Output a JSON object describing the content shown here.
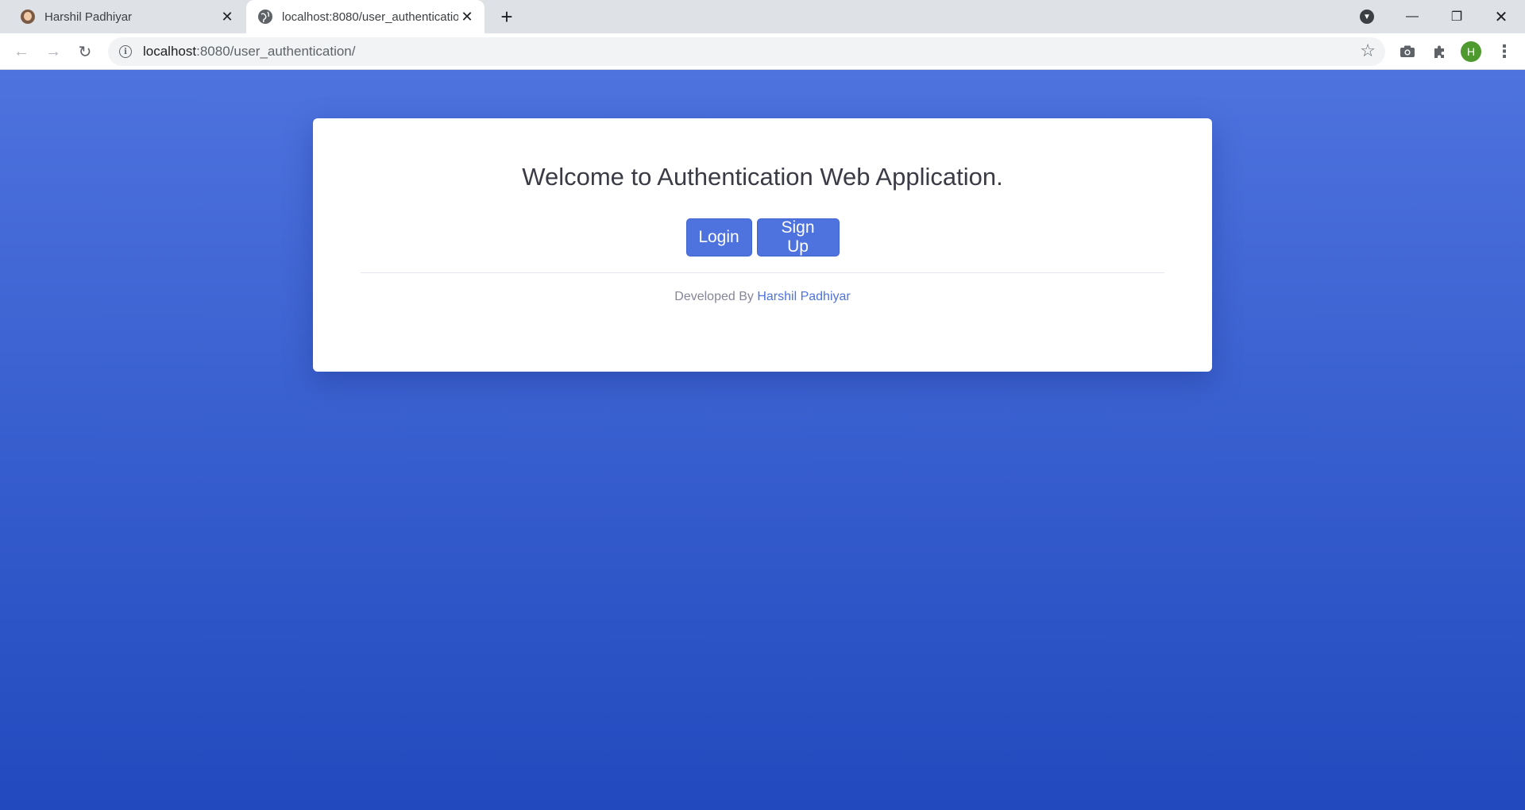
{
  "browser": {
    "tabs": [
      {
        "title": "Harshil Padhiyar",
        "active": false
      },
      {
        "title": "localhost:8080/user_authentication/",
        "active": true
      }
    ],
    "url_host": "localhost",
    "url_path": ":8080/user_authentication/",
    "profile_initial": "H"
  },
  "page": {
    "heading": "Welcome to Authentication Web Application.",
    "login_label": "Login",
    "signup_label": "Sign Up",
    "footer_prefix": "Developed By",
    "footer_author": "Harshil Padhiyar"
  },
  "colors": {
    "primary": "#4e73df",
    "background_top": "#4e73df",
    "background_bottom": "#224abe",
    "heading_text": "#3a3b45",
    "footer_text": "#858796"
  },
  "icons": {
    "back": "arrow-left-icon",
    "forward": "arrow-right-icon",
    "reload": "reload-icon",
    "site_info": "info-icon",
    "bookmark": "star-icon",
    "camera": "camera-icon",
    "extensions": "puzzle-icon",
    "menu": "kebab-menu-icon"
  }
}
